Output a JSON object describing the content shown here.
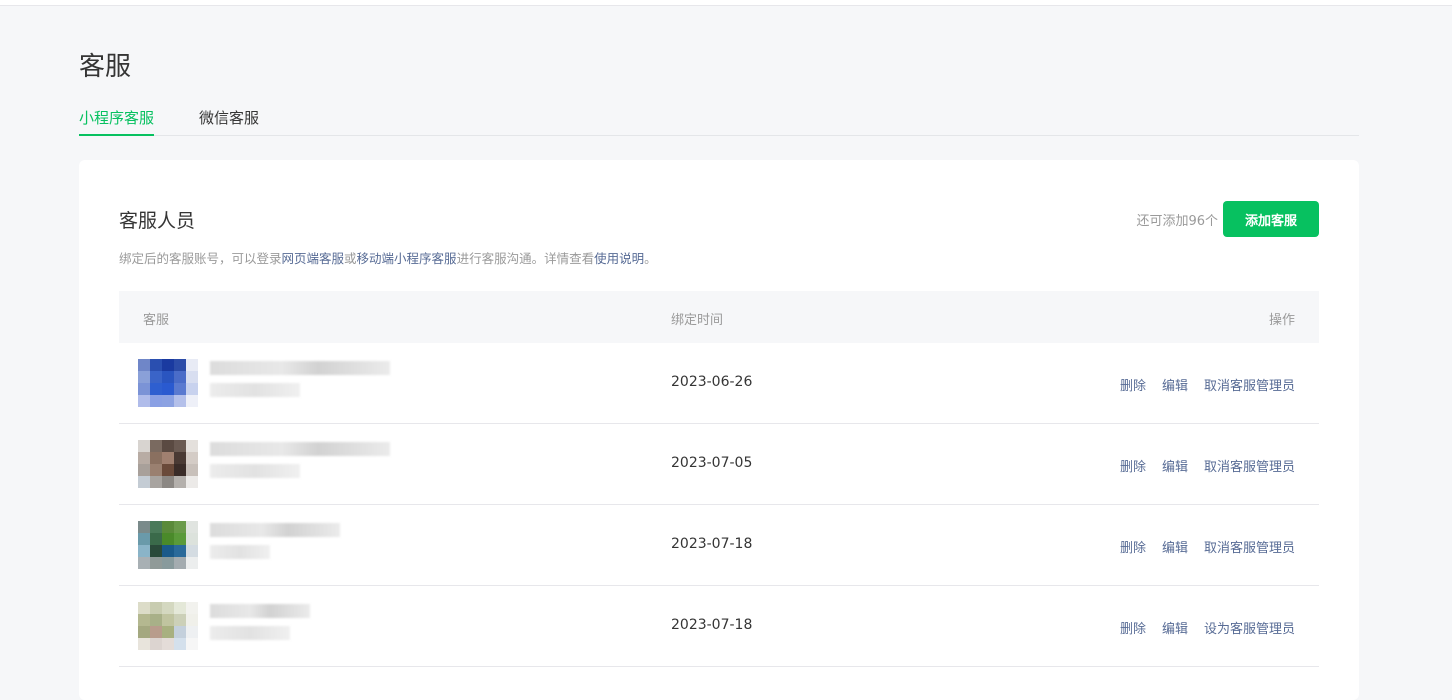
{
  "page": {
    "title": "客服"
  },
  "tabs": [
    {
      "label": "小程序客服",
      "active": true
    },
    {
      "label": "微信客服",
      "active": false
    }
  ],
  "card": {
    "title": "客服人员",
    "remain": "还可添加96个",
    "add_button": "添加客服",
    "desc_prefix": "绑定后的客服账号，可以登录",
    "desc_link1": "网页端客服",
    "desc_mid": "或",
    "desc_link2": "移动端小程序客服",
    "desc_mid2": "进行客服沟通。详情查看",
    "desc_link3": "使用说明",
    "desc_suffix": "。"
  },
  "table": {
    "headers": [
      "客服",
      "绑定时间",
      "操作"
    ],
    "rows": [
      {
        "date": "2023-06-26",
        "ops": [
          "删除",
          "编辑",
          "取消客服管理员"
        ]
      },
      {
        "date": "2023-07-05",
        "ops": [
          "删除",
          "编辑",
          "取消客服管理员"
        ]
      },
      {
        "date": "2023-07-18",
        "ops": [
          "删除",
          "编辑",
          "取消客服管理员"
        ]
      },
      {
        "date": "2023-07-18",
        "ops": [
          "删除",
          "编辑",
          "设为客服管理员"
        ]
      }
    ]
  },
  "colors": {
    "accent": "#07c160",
    "link": "#576b95"
  }
}
